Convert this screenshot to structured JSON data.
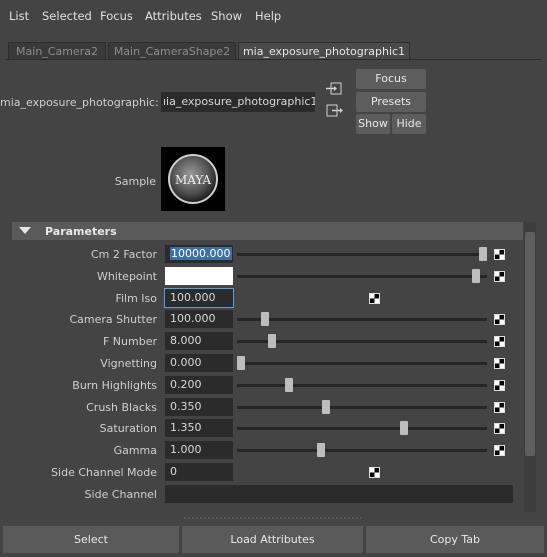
{
  "menu": [
    "List",
    "Selected",
    "Focus",
    "Attributes",
    "Show",
    "Help"
  ],
  "tabs": [
    "Main_Camera2",
    "Main_CameraShape2",
    "mia_exposure_photographic1"
  ],
  "node": {
    "label": "mia_exposure_photographic:",
    "value": "ıia_exposure_photographic1"
  },
  "buttons": {
    "focus": "Focus",
    "presets": "Presets",
    "show": "Show",
    "hide": "Hide"
  },
  "sample": {
    "label": "Sample",
    "logo_text": "MAYA"
  },
  "frame": {
    "title": "Parameters"
  },
  "params": [
    {
      "label": "Cm 2 Factor",
      "value": "10000.000",
      "slider": 1.0,
      "selected": true
    },
    {
      "label": "Whitepoint",
      "value": "",
      "slider": 0.97,
      "color": "#ffffff"
    },
    {
      "label": "Film Iso",
      "value": "100.000",
      "focused": true
    },
    {
      "label": "Camera Shutter",
      "value": "100.000",
      "slider": 0.1
    },
    {
      "label": "F Number",
      "value": "8.000",
      "slider": 0.13
    },
    {
      "label": "Vignetting",
      "value": "0.000",
      "slider": 0.0
    },
    {
      "label": "Burn Highlights",
      "value": "0.200",
      "slider": 0.2
    },
    {
      "label": "Crush Blacks",
      "value": "0.350",
      "slider": 0.35
    },
    {
      "label": "Saturation",
      "value": "1.350",
      "slider": 0.675
    },
    {
      "label": "Gamma",
      "value": "1.000",
      "slider": 0.33
    },
    {
      "label": "Side Channel Mode",
      "value": "0"
    },
    {
      "label": "Side Channel",
      "value": ""
    }
  ],
  "bottom": {
    "select": "Select",
    "load": "Load Attributes",
    "copy": "Copy Tab"
  }
}
